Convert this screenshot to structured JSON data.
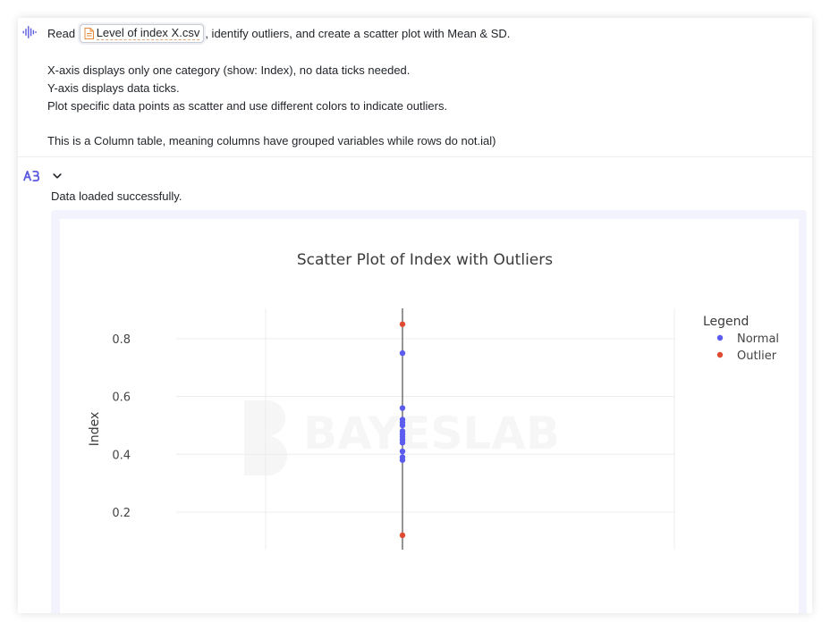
{
  "user_message": {
    "prefix": "Read",
    "file_chip": {
      "name": "Level of index X.csv",
      "icon": "csv-file-icon"
    },
    "suffix": ", identify outliers, and create a scatter plot with Mean & SD.",
    "lines": [
      "X-axis displays only one category (show: Index), no data ticks needed.",
      "Y-axis displays data ticks.",
      "Plot specific data points as scatter and use different colors to indicate outliers.",
      "This is a Column table, meaning columns have grouped variables while rows do not.ial)"
    ]
  },
  "assistant": {
    "logo": "bayeslab-logo-icon",
    "collapse_icon": "chevron-down-icon",
    "status": "Data loaded successfully."
  },
  "watermark": "BAYESLAB",
  "colors": {
    "normal": "#5b5bf0",
    "outlier": "#e04a31",
    "accent": "#5b5bdf",
    "panel": "#f3f3fd"
  },
  "chart_data": {
    "type": "scatter",
    "title": "Scatter Plot of Index with Outliers",
    "xlabel": "",
    "ylabel": "Index",
    "ylim": [
      0.07,
      0.905
    ],
    "yticks": [
      0.2,
      0.4,
      0.6,
      0.8
    ],
    "ytick_labels": [
      "0.2",
      "0.4",
      "0.6",
      "0.8"
    ],
    "grid": true,
    "legend_title": "Legend",
    "legend_position": "top-right",
    "series": [
      {
        "name": "Normal",
        "color": "#5b5bf0",
        "values": [
          0.75,
          0.56,
          0.52,
          0.51,
          0.5,
          0.48,
          0.47,
          0.46,
          0.45,
          0.44,
          0.41,
          0.39,
          0.38
        ]
      },
      {
        "name": "Outlier",
        "color": "#e04a31",
        "values": [
          0.85,
          0.12
        ]
      }
    ]
  }
}
